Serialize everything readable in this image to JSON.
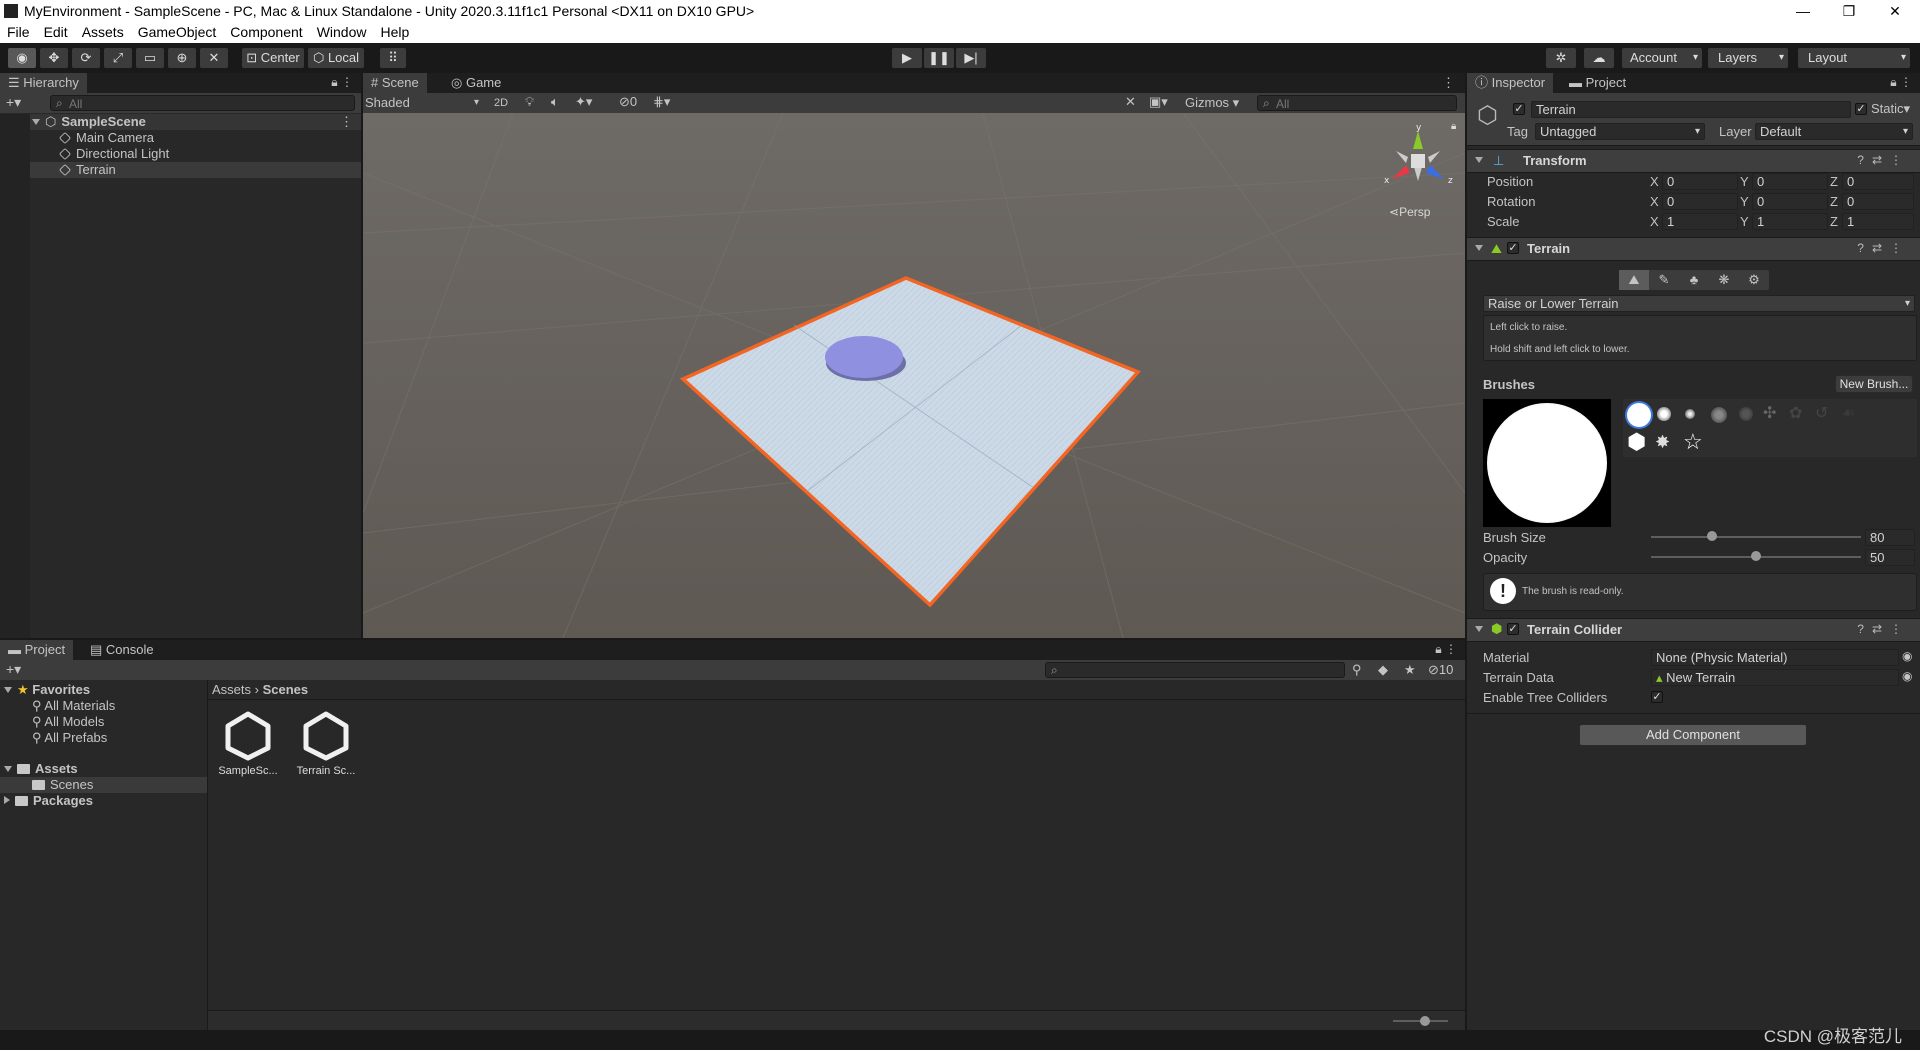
{
  "window": {
    "title": "MyEnvironment - SampleScene - PC, Mac & Linux Standalone - Unity 2020.3.11f1c1 Personal <DX11 on DX10 GPU>",
    "minimize": "—",
    "maximize": "❐",
    "close": "✕"
  },
  "menu": [
    "File",
    "Edit",
    "Assets",
    "GameObject",
    "Component",
    "Window",
    "Help"
  ],
  "toolbar": {
    "pivot_label": "Center",
    "space_label": "Local",
    "account_label": "Account",
    "layers_label": "Layers",
    "layout_label": "Layout"
  },
  "hierarchy": {
    "tab_label": "Hierarchy",
    "search_placeholder": "All",
    "scene_name": "SampleScene",
    "items": [
      "Main Camera",
      "Directional Light",
      "Terrain"
    ]
  },
  "scene_view": {
    "tabs": [
      "Scene",
      "Game"
    ],
    "shading_mode": "Shaded",
    "mode_2d": "2D",
    "hidden_count": "0",
    "gizmos_label": "Gizmos",
    "search_placeholder": "All",
    "projection_label": "Persp",
    "axis_labels": {
      "x": "x",
      "y": "y",
      "z": "z"
    },
    "selection_color": "#f26522",
    "terrain_color": "#c9d7e4",
    "sky_color": "#6b6560"
  },
  "project": {
    "tabs": [
      "Project",
      "Console"
    ],
    "hidden_count": "10",
    "favorites_label": "Favorites",
    "favorites": [
      "All Materials",
      "All Models",
      "All Prefabs"
    ],
    "assets_label": "Assets",
    "assets_children": [
      "Scenes"
    ],
    "packages_label": "Packages",
    "breadcrumb": [
      "Assets",
      "Scenes"
    ],
    "files": [
      "SampleSc...",
      "Terrain Sc..."
    ]
  },
  "inspector": {
    "tabs": [
      "Inspector",
      "Project"
    ],
    "object_name": "Terrain",
    "static_label": "Static",
    "tag_label": "Tag",
    "tag_value": "Untagged",
    "layer_label": "Layer",
    "layer_value": "Default",
    "transform": {
      "title": "Transform",
      "rows": [
        {
          "label": "Position",
          "x": "0",
          "y": "0",
          "z": "0"
        },
        {
          "label": "Rotation",
          "x": "0",
          "y": "0",
          "z": "0"
        },
        {
          "label": "Scale",
          "x": "1",
          "y": "1",
          "z": "1"
        }
      ],
      "axis": [
        "X",
        "Y",
        "Z"
      ]
    },
    "terrain": {
      "title": "Terrain",
      "tool_dropdown": "Raise or Lower Terrain",
      "help_line1": "Left click to raise.",
      "help_line2": "Hold shift and left click to lower.",
      "brushes_label": "Brushes",
      "new_brush_label": "New Brush...",
      "brush_size_label": "Brush Size",
      "brush_size_value": "80",
      "brush_size_fraction": 0.29,
      "opacity_label": "Opacity",
      "opacity_value": "50",
      "opacity_fraction": 0.5,
      "readonly_msg": "The brush is read-only."
    },
    "terrain_collider": {
      "title": "Terrain Collider",
      "material_label": "Material",
      "material_value": "None (Physic Material)",
      "terrain_data_label": "Terrain Data",
      "terrain_data_value": "New Terrain",
      "tree_colliders_label": "Enable Tree Colliders"
    },
    "add_component_label": "Add Component"
  },
  "watermark": "CSDN @极客范儿"
}
